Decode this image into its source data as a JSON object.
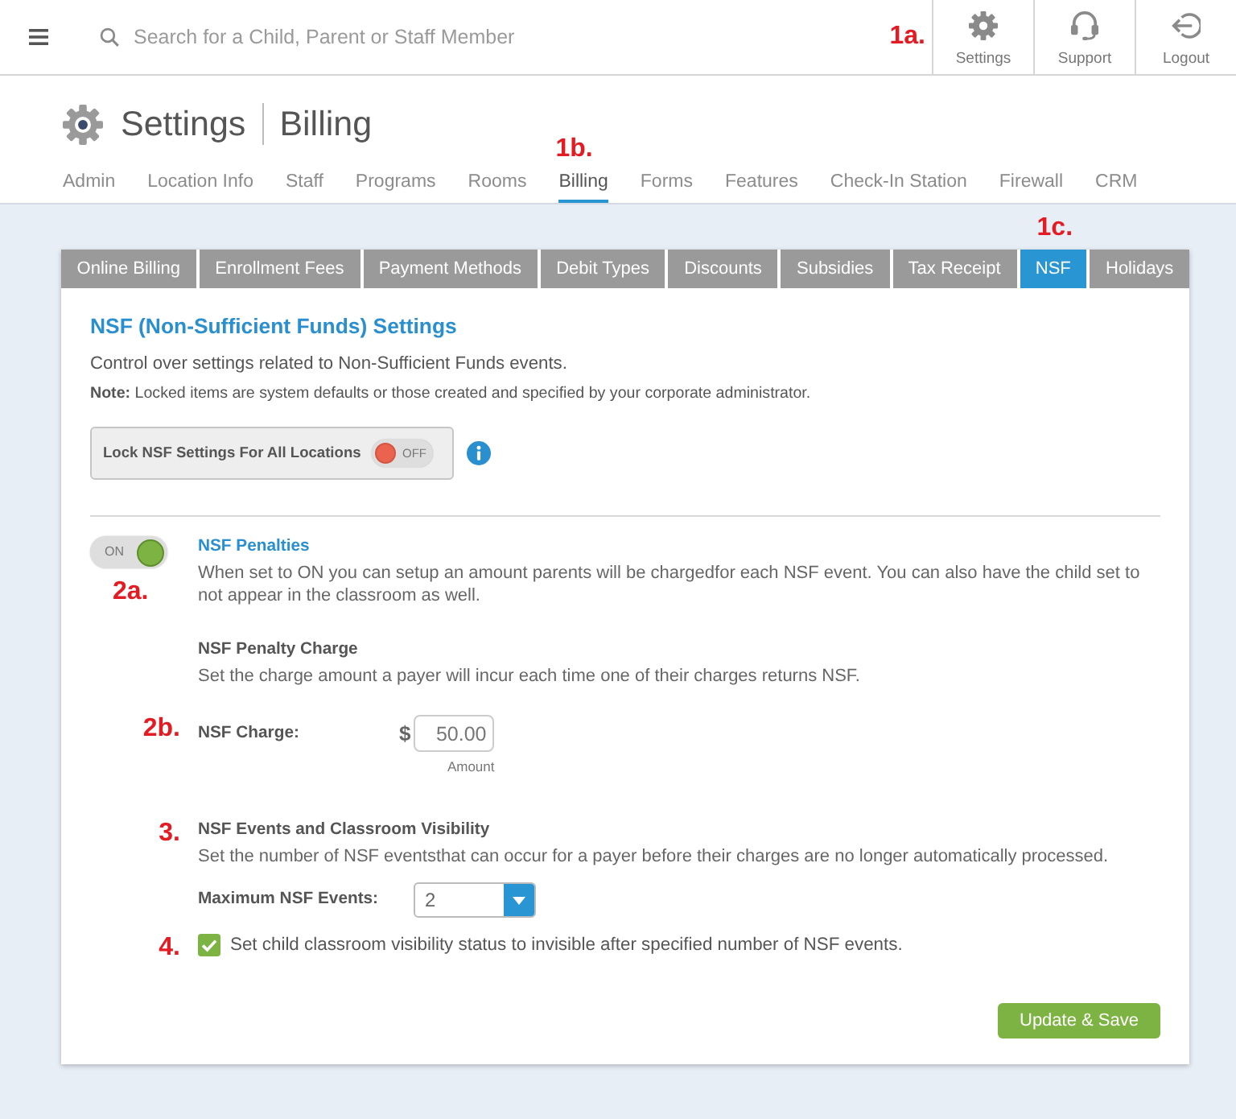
{
  "top_bar": {
    "search": {
      "placeholder": "Search for a Child, Parent or Staff Member"
    },
    "marker": "1a.",
    "actions": [
      {
        "label": "Settings"
      },
      {
        "label": "Support"
      },
      {
        "label": "Logout"
      }
    ]
  },
  "header": {
    "title": "Settings",
    "subtitle": "Billing"
  },
  "nav": [
    {
      "label": "Admin",
      "selected": false
    },
    {
      "label": "Location Info",
      "selected": false
    },
    {
      "label": "Staff",
      "selected": false
    },
    {
      "label": "Programs",
      "selected": false
    },
    {
      "label": "Rooms",
      "selected": false
    },
    {
      "label": "Billing",
      "selected": true,
      "marker": "1b."
    },
    {
      "label": "Forms",
      "selected": false
    },
    {
      "label": "Features",
      "selected": false
    },
    {
      "label": "Check-In Station",
      "selected": false
    },
    {
      "label": "Firewall",
      "selected": false
    },
    {
      "label": "CRM",
      "selected": false
    }
  ],
  "tabs": [
    {
      "label": "Online Billing",
      "selected": false
    },
    {
      "label": "Enrollment Fees",
      "selected": false
    },
    {
      "label": "Payment Methods",
      "selected": false
    },
    {
      "label": "Debit Types",
      "selected": false
    },
    {
      "label": "Discounts",
      "selected": false
    },
    {
      "label": "Subsidies",
      "selected": false
    },
    {
      "label": "Tax Receipt",
      "selected": false
    },
    {
      "label": "NSF",
      "selected": true,
      "marker": "1c."
    },
    {
      "label": "Holidays",
      "selected": false
    }
  ],
  "panel": {
    "title": "NSF (Non-Sufficient Funds) Settings",
    "description": "Control over settings related to Non-Sufficient Funds events.",
    "note": "**Note:** Locked items are system defaults or those created and specified by your corporate administrator.",
    "lock": {
      "label": "Lock NSF Settings For All Locations",
      "on": false,
      "toggle_text": "OFF"
    }
  },
  "penalties": {
    "marker": "2a.",
    "on": true,
    "toggle_text": "ON",
    "title": "NSF Penalties",
    "description": "When set to ON you can setup an amount parents will be chargedfor each NSF event. You can also have the child set to not appear in the classroom as well.",
    "charge": {
      "title": "NSF Penalty Charge",
      "description": "Set the charge amount a payer will incur each time one of their charges returns NSF.",
      "marker": "2b.",
      "label": "NSF Charge:",
      "currency": "$",
      "value": "50.00",
      "caption": "Amount"
    }
  },
  "events": {
    "marker": "3.",
    "title": "NSF Events and Classroom Visibility",
    "description": "Set the number of NSF eventsthat can occur for a payer before their charges are no longer automatically processed.",
    "max_events": {
      "label": "Maximum NSF Events:",
      "value": "2"
    },
    "visibility": {
      "marker": "4.",
      "checked": true,
      "label": "Set child classroom visibility status to invisible after specified number of NSF events."
    }
  },
  "save_button": {
    "label": "Update & Save"
  }
}
